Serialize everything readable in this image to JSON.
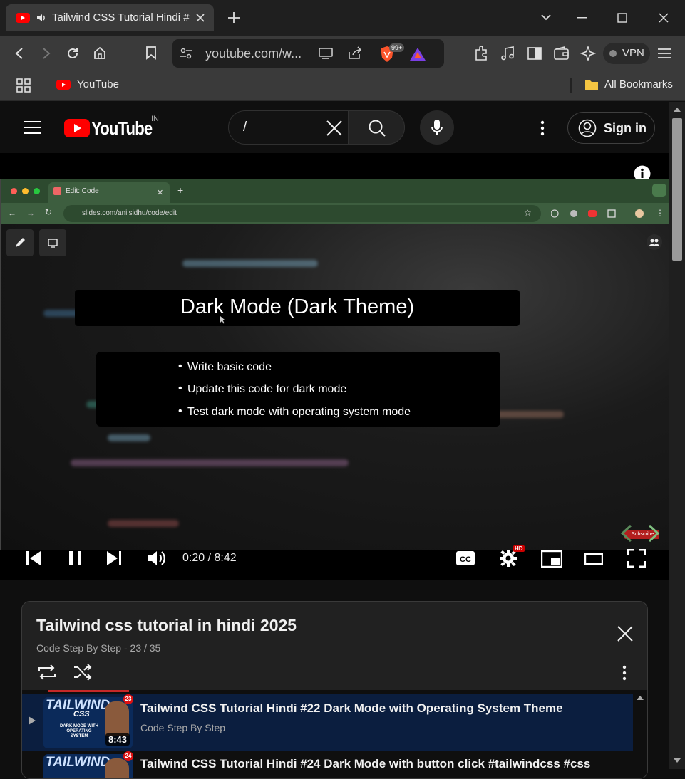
{
  "browser": {
    "tab_title": "Tailwind CSS Tutorial Hindi #",
    "url": "youtube.com/w...",
    "shield_count": "99+",
    "vpn_label": "VPN",
    "bookmarks": [
      {
        "label": "YouTube"
      },
      {
        "label": "All Bookmarks"
      }
    ]
  },
  "youtube": {
    "logo_text": "YouTube",
    "country_code": "IN",
    "search_value": "/",
    "signin_label": "Sign in"
  },
  "video": {
    "inner_browser": {
      "tab_title": "Edit: Code",
      "url": "slides.com/anilsidhu/code/edit"
    },
    "slide": {
      "title": "Dark Mode (Dark Theme)",
      "bullets": [
        "Write basic code",
        "Update this code for dark mode",
        "Test dark mode with operating system mode"
      ]
    },
    "subscribe_watermark": "Subscribe",
    "time_display": "0:20 / 8:42",
    "hd_badge": "HD",
    "progress_fraction": 0.038
  },
  "playlist": {
    "title": "Tailwind css tutorial in hindi 2025",
    "channel": "Code Step By Step",
    "position": "23 / 35",
    "items": [
      {
        "title": "Tailwind CSS Tutorial Hindi #22 Dark Mode with Operating System Theme",
        "channel": "Code Step By Step",
        "duration": "8:43",
        "badge": "23",
        "thumb_text": "TAILWIND",
        "thumb_sub": "CSS",
        "thumb_caption": "DARK MODE WITH OPERATING SYSTEM"
      },
      {
        "title": "Tailwind CSS Tutorial Hindi #24 Dark Mode with button click #tailwindcss #css",
        "badge": "24",
        "thumb_text": "TAILWIND"
      }
    ]
  },
  "colors": {
    "yt_red": "#ff0000",
    "bg": "#0f0f0f",
    "chrome": "#3a3a3a"
  }
}
